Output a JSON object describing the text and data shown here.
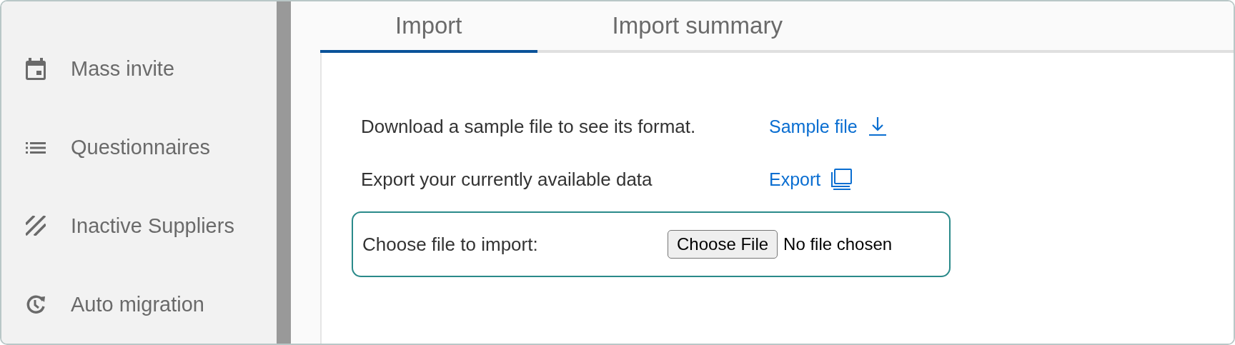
{
  "sidebar": {
    "items": [
      {
        "label": "Mass invite",
        "kind": "calendar"
      },
      {
        "label": "Questionnaires",
        "kind": "list"
      },
      {
        "label": "Inactive Suppliers",
        "kind": "stripes"
      },
      {
        "label": "Auto migration",
        "kind": "history"
      }
    ]
  },
  "tabs": [
    {
      "label": "Import",
      "selected": true
    },
    {
      "label": "Import summary",
      "selected": false
    }
  ],
  "import": {
    "rows": [
      {
        "text": "Download a sample file to see its format.",
        "link": "Sample file",
        "kind": "download"
      },
      {
        "text": "Export your currently available data",
        "link": "Export",
        "kind": "export"
      }
    ],
    "file_input": {
      "label": "Choose file to import:",
      "button": "Choose File",
      "status": "No file chosen"
    }
  }
}
